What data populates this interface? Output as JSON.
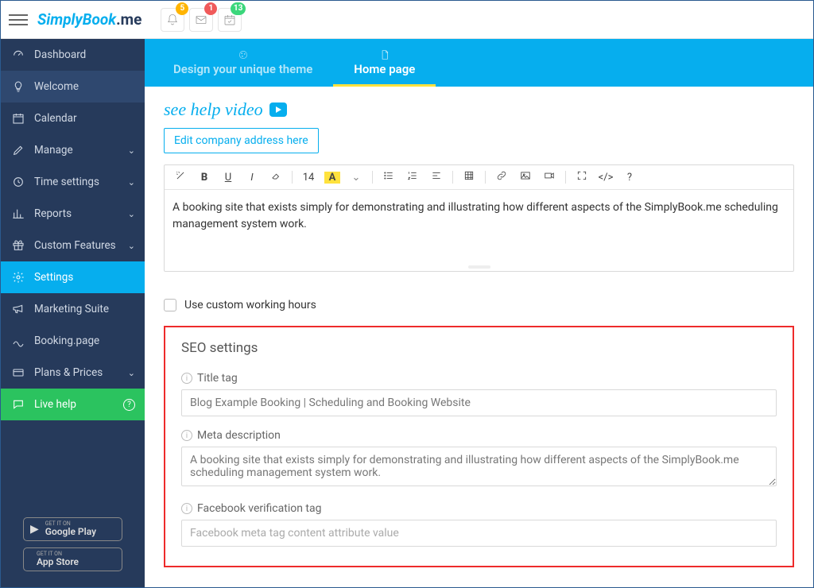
{
  "header": {
    "logo_main": "SimplyBook",
    "logo_suffix": ".me",
    "badges": {
      "bell": "5",
      "mail": "1",
      "cal": "13"
    }
  },
  "sidebar": {
    "items": [
      {
        "label": "Dashboard"
      },
      {
        "label": "Welcome"
      },
      {
        "label": "Calendar"
      },
      {
        "label": "Manage"
      },
      {
        "label": "Time settings"
      },
      {
        "label": "Reports"
      },
      {
        "label": "Custom Features"
      },
      {
        "label": "Settings"
      },
      {
        "label": "Marketing Suite"
      },
      {
        "label": "Booking.page"
      },
      {
        "label": "Plans & Prices"
      },
      {
        "label": "Live help"
      }
    ],
    "store": {
      "google_tiny": "GET IT ON",
      "google": "Google Play",
      "apple_tiny": "GET IT ON",
      "apple": "App Store"
    }
  },
  "tabs": {
    "design": "Design your unique theme",
    "home": "Home page"
  },
  "page": {
    "help_video": "see help video",
    "edit_address": "Edit company address here",
    "editor_text": "A booking site that exists simply for demonstrating and illustrating how different aspects of the SimplyBook.me scheduling management system work.",
    "toolbar_fontsize": "14",
    "custom_hours": "Use custom working hours",
    "seo_heading": "SEO settings",
    "title_tag_label": "Title tag",
    "title_tag_value": "Blog Example Booking | Scheduling and Booking Website",
    "meta_desc_label": "Meta description",
    "meta_desc_value": "A booking site that exists simply for demonstrating and illustrating how different aspects of the SimplyBook.me scheduling management system work.",
    "fb_tag_label": "Facebook verification tag",
    "fb_tag_placeholder": "Facebook meta tag content attribute value"
  }
}
